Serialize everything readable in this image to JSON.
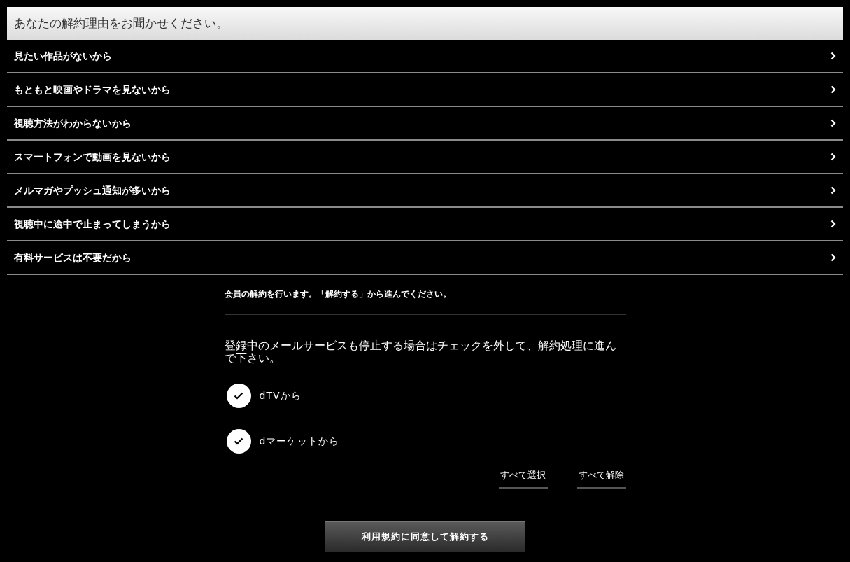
{
  "header": {
    "title": "あなたの解約理由をお聞かせください。"
  },
  "reasons": [
    {
      "label": "見たい作品がないから"
    },
    {
      "label": "もともと映画やドラマを見ないから"
    },
    {
      "label": "視聴方法がわからないから"
    },
    {
      "label": "スマートフォンで動画を見ないから"
    },
    {
      "label": "メルマガやプッシュ通知が多いから"
    },
    {
      "label": "視聴中に途中で止まってしまうから"
    },
    {
      "label": "有料サービスは不要だから"
    }
  ],
  "notice": "会員の解約を行います。「解約する」から進んでください。",
  "mail_section": {
    "heading": "登録中のメールサービスも停止する場合はチェックを外して、解約処理に進んで下さい。",
    "options": [
      {
        "label": "dTVから",
        "checked": true
      },
      {
        "label": "dマーケットから",
        "checked": true
      }
    ],
    "links": [
      "すべて選択",
      "すべて解除"
    ]
  },
  "submit_button": "利用規約に同意して解約する"
}
